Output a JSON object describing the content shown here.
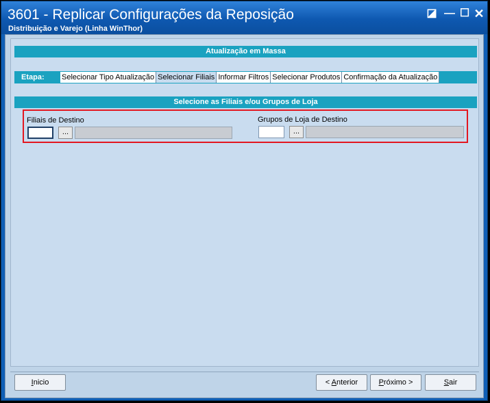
{
  "window": {
    "title": "3601 - Replicar Configurações da Reposição",
    "subtitle": "Distribuição e Varejo (Linha WinThor)",
    "controls": {
      "restore": "◪",
      "minimize": "—",
      "maximize": "☐",
      "close": "✕"
    }
  },
  "sections": {
    "mass_update": "Atualização em Massa",
    "select_branches": "Selecione as Filiais e/ou Grupos de Loja"
  },
  "steps": {
    "label": "Etapa:",
    "tabs": [
      {
        "label": "Selecionar Tipo Atualização",
        "active": false
      },
      {
        "label": "Selecionar Filiais",
        "active": true
      },
      {
        "label": "Informar Filtros",
        "active": false
      },
      {
        "label": "Selecionar Produtos",
        "active": false
      },
      {
        "label": "Confirmação da Atualização",
        "active": false
      }
    ]
  },
  "fields": {
    "branches": {
      "label": "Filiais de Destino",
      "value": "",
      "browse": "..."
    },
    "store_groups": {
      "label": "Grupos de Loja de Destino",
      "value": "",
      "browse": "..."
    }
  },
  "buttons": {
    "start": {
      "mnemonic": "I",
      "rest": "nicio"
    },
    "previous": {
      "prefix": "< ",
      "mnemonic": "A",
      "rest": "nterior"
    },
    "next": {
      "mnemonic": "P",
      "rest": "róximo >"
    },
    "exit": {
      "mnemonic": "S",
      "rest": "air"
    }
  },
  "colors": {
    "title_bar": "#0e58b0",
    "section_bar": "#1aa2c0",
    "highlight": "#e3161f"
  }
}
